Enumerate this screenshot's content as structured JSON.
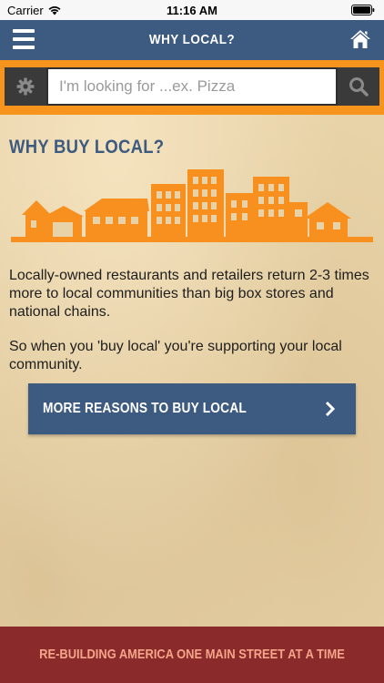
{
  "status_bar": {
    "carrier": "Carrier",
    "time": "11:16 AM",
    "icons": [
      "wifi-icon",
      "battery-icon"
    ]
  },
  "nav": {
    "title": "WHY LOCAL?",
    "left_icon": "menu-icon",
    "right_icon": "home-icon"
  },
  "search": {
    "placeholder": "I'm looking for ...ex. Pizza",
    "value": "",
    "settings_icon": "gear-icon",
    "submit_icon": "search-icon"
  },
  "content": {
    "title": "WHY BUY LOCAL?",
    "illustration": "city-skyline-illustration",
    "paragraph_1": "Locally-owned restaurants and retailers return 2-3 times more to local communities than big box stores and national chains.",
    "paragraph_2": "So when you 'buy local' you're supporting your local community.",
    "reasons_button_label": "MORE REASONS TO BUY LOCAL"
  },
  "footer": {
    "text": "RE-BUILDING AMERICA ONE MAIN STREET AT A TIME"
  },
  "colors": {
    "nav_blue": "#3d5a80",
    "accent_orange": "#f7941d",
    "illustration_orange": "#f7901e",
    "footer_red": "#8b2a2a",
    "footer_text": "#f4a58a",
    "background_parchment": "#e8d3a8"
  }
}
